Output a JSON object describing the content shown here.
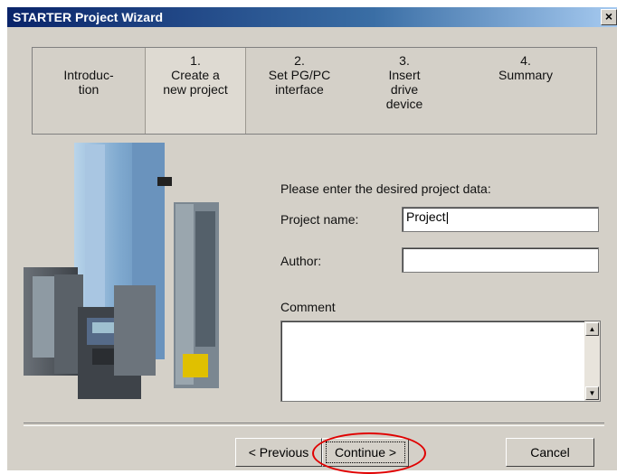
{
  "window": {
    "title": "STARTER Project Wizard",
    "close_label": "×"
  },
  "steps": [
    {
      "num": "",
      "label": "Introduc-\ntion",
      "active": false
    },
    {
      "num": "1.",
      "label": "Create a\nnew project",
      "active": true
    },
    {
      "num": "2.",
      "label": "Set PG/PC\ninterface",
      "active": false
    },
    {
      "num": "3.",
      "label": "Insert\ndrive\ndevice",
      "active": false
    },
    {
      "num": "4.",
      "label": "Summary",
      "active": false
    }
  ],
  "form": {
    "prompt": "Please enter the desired project data:",
    "project_name_label": "Project name:",
    "project_name_value": "Project|",
    "author_label": "Author:",
    "author_value": "",
    "comment_label": "Comment",
    "comment_value": ""
  },
  "buttons": {
    "previous": "< Previous",
    "continue": "Continue >",
    "cancel": "Cancel"
  },
  "colors": {
    "title_gradient_start": "#0a246a",
    "dialog_bg": "#d4d0c8",
    "highlight_ellipse": "#e00000"
  },
  "icons": {
    "close": "close-icon",
    "scroll_up": "scroll-up-icon",
    "scroll_down": "scroll-down-icon"
  },
  "illustration": "siemens-drive-units-image"
}
